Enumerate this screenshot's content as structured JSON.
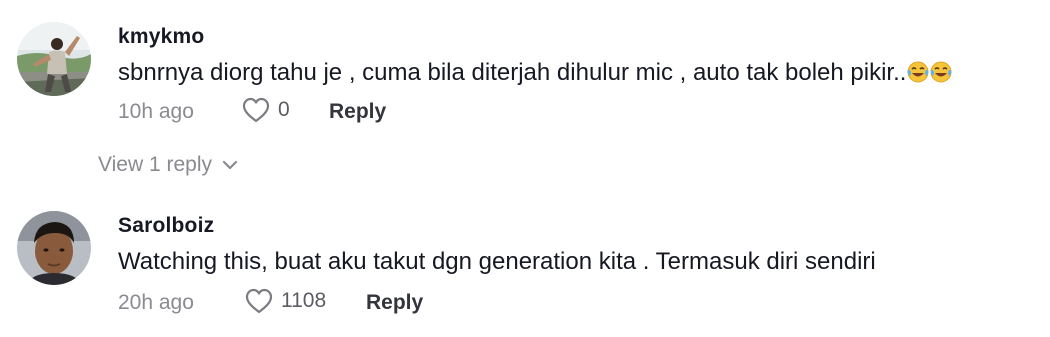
{
  "comments": [
    {
      "avatar": "user-photo-avatar",
      "username": "kmykmo",
      "text": "sbnrnya diorg tahu je , cuma bila diterjah dihulur mic , auto tak boleh pikir..",
      "emojis": [
        "face-with-tears-of-joy-icon",
        "face-with-tears-of-joy-icon"
      ],
      "time": "10h ago",
      "likes": "0",
      "reply_label": "Reply"
    },
    {
      "avatar": "user-photo-avatar",
      "username": "Sarolboiz",
      "text": "Watching this, buat aku takut dgn generation kita . Termasuk diri sendiri",
      "time": "20h ago",
      "likes": "1108",
      "reply_label": "Reply"
    }
  ],
  "view_replies": {
    "label": "View 1 reply",
    "icon": "chevron-down-icon"
  },
  "colors": {
    "text": "#161823",
    "muted": "#8a8b91",
    "like_count": "#5c5d63",
    "reply": "#33343c"
  }
}
